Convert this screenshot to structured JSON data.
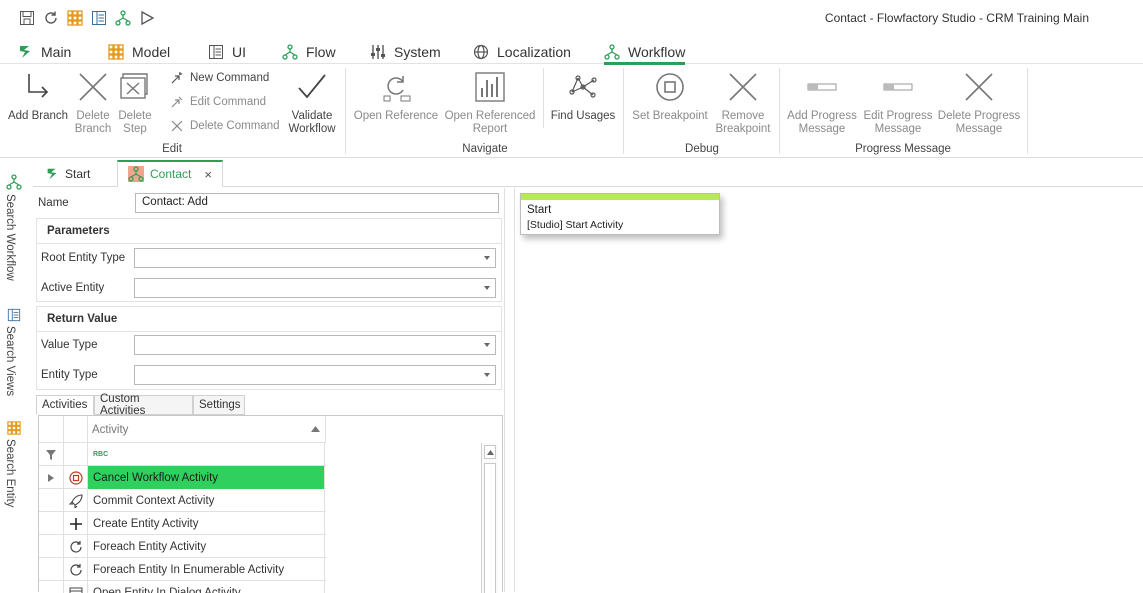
{
  "window_title": "Contact  - Flowfactory Studio - CRM Training Main",
  "quick_access": [
    "save-icon",
    "refresh-icon",
    "entity-grid-icon",
    "view-icon",
    "flow-icon",
    "run-icon"
  ],
  "menu_tabs": [
    {
      "label": "Main",
      "icon": "main-icon"
    },
    {
      "label": "Model",
      "icon": "model-grid-icon"
    },
    {
      "label": "UI",
      "icon": "ui-icon"
    },
    {
      "label": "Flow",
      "icon": "flow-icon"
    },
    {
      "label": "System",
      "icon": "system-icon"
    },
    {
      "label": "Localization",
      "icon": "globe-icon"
    },
    {
      "label": "Workflow",
      "icon": "workflow-icon",
      "active": true
    }
  ],
  "ribbon": {
    "edit": {
      "add_branch": "Add Branch",
      "delete_branch_1": "Delete",
      "delete_branch_2": "Branch",
      "delete_step_1": "Delete",
      "delete_step_2": "Step",
      "new_command": "New Command",
      "edit_command": "Edit Command",
      "delete_command": "Delete Command",
      "validate_1": "Validate",
      "validate_2": "Workflow",
      "group_label": "Edit"
    },
    "navigate": {
      "open_reference": "Open Reference",
      "open_referenced_1": "Open Referenced",
      "open_referenced_2": "Report",
      "find_usages": "Find Usages",
      "group_label": "Navigate"
    },
    "debug": {
      "set_breakpoint": "Set Breakpoint",
      "remove_1": "Remove",
      "remove_2": "Breakpoint",
      "group_label": "Debug"
    },
    "progress": {
      "add_1": "Add Progress",
      "add_2": "Message",
      "edit_1": "Edit Progress",
      "edit_2": "Message",
      "delete_1": "Delete Progress",
      "delete_2": "Message",
      "group_label": "Progress Message"
    }
  },
  "side_bar": {
    "search_workflow": "Search Workflow",
    "search_views": "Search Views",
    "search_entity": "Search Entity"
  },
  "doc_tabs": [
    {
      "label": "Start"
    },
    {
      "label": "Contact",
      "active": true
    }
  ],
  "form": {
    "name_label": "Name",
    "name_value": "Contact: Add",
    "parameters_heading": "Parameters",
    "root_entity_type_label": "Root Entity Type",
    "active_entity_label": "Active Entity",
    "return_value_heading": "Return Value",
    "value_type_label": "Value Type",
    "entity_type_label": "Entity Type"
  },
  "panel_tabs": [
    "Activities",
    "Custom Activities",
    "Settings"
  ],
  "grid": {
    "column_header": "Activity",
    "filter_glyph": "RBC",
    "rows": [
      {
        "label": "Cancel Workflow Activity",
        "icon": "cancel-icon",
        "selected": true
      },
      {
        "label": "Commit Context Activity",
        "icon": "rocket-icon"
      },
      {
        "label": "Create Entity Activity",
        "icon": "plus-icon"
      },
      {
        "label": "Foreach Entity Activity",
        "icon": "loop-icon"
      },
      {
        "label": "Foreach Entity In Enumerable Activity",
        "icon": "loop-icon"
      },
      {
        "label": "Open Entity In Dialog Activity",
        "icon": "dialog-icon"
      }
    ]
  },
  "canvas": {
    "node_title": "Start",
    "node_subtitle": "[Studio] Start Activity"
  },
  "colors": {
    "accent": "#2e9e57",
    "selected_row": "#2fd05d",
    "node_bar": "#b6e95a"
  }
}
